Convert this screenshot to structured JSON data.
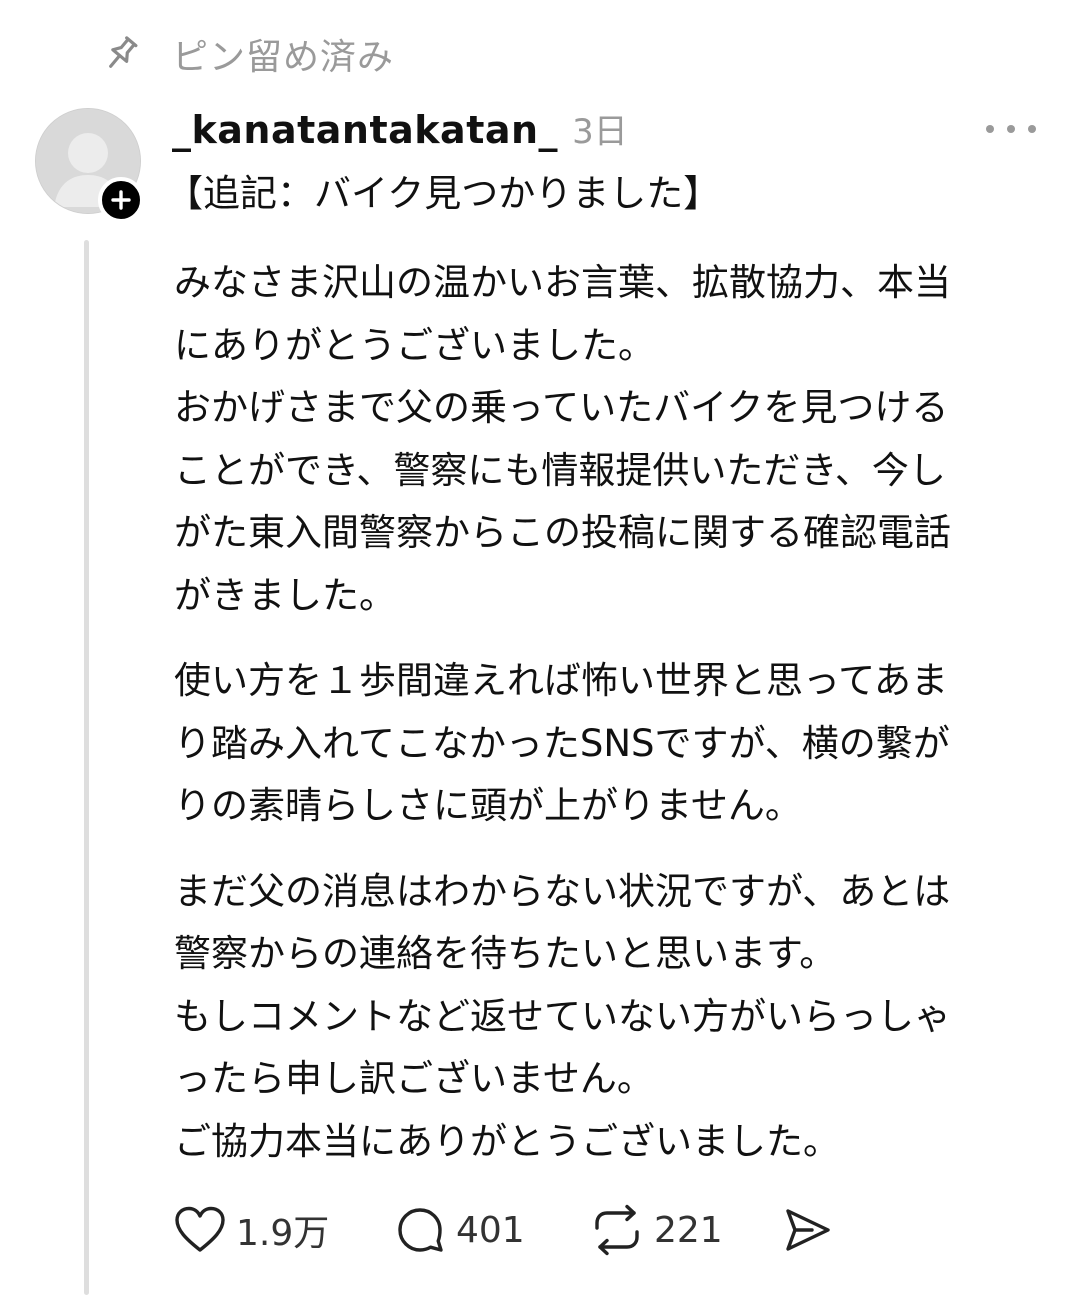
{
  "pinned": {
    "icon": "pin-icon",
    "label": "ピン留め済み"
  },
  "post": {
    "avatar_icon": "default-avatar-icon",
    "follow_icon": "plus-icon",
    "username": "_kanatantakatan_",
    "time": "3日",
    "more_icon": "more-horizontal-icon",
    "heading": "【追記：バイク見つかりました】",
    "paragraphs": [
      {
        "lines": [
          "みなさま沢山の温かいお言葉、拡散協力、本当",
          "にありがとうございました。",
          "おかげさまで父の乗っていたバイクを見つける",
          "ことができ、警察にも情報提供いただき、今し",
          "がた東入間警察からこの投稿に関する確認電話",
          "がきました。"
        ]
      },
      {
        "lines": [
          "使い方を１歩間違えれば怖い世界と思ってあま",
          "り踏み入れてこなかったSNSですが、横の繋が",
          "りの素晴らしさに頭が上がりません。"
        ]
      },
      {
        "lines": [
          "まだ父の消息はわからない状況ですが、あとは",
          "警察からの連絡を待ちたいと思います。",
          "もしコメントなど返せていない方がいらっしゃ",
          "ったら申し訳ございません。",
          "ご協力本当にありがとうございました。"
        ]
      }
    ],
    "actions": {
      "like": {
        "icon": "heart-icon",
        "count": "1.9万"
      },
      "reply": {
        "icon": "comment-icon",
        "count": "401"
      },
      "repost": {
        "icon": "repost-icon",
        "count": "221"
      },
      "share": {
        "icon": "send-icon"
      }
    }
  },
  "colors": {
    "text": "#111111",
    "muted": "#9a9a9a",
    "thread_line": "#dedede",
    "avatar_bg": "#dcdcdc"
  }
}
